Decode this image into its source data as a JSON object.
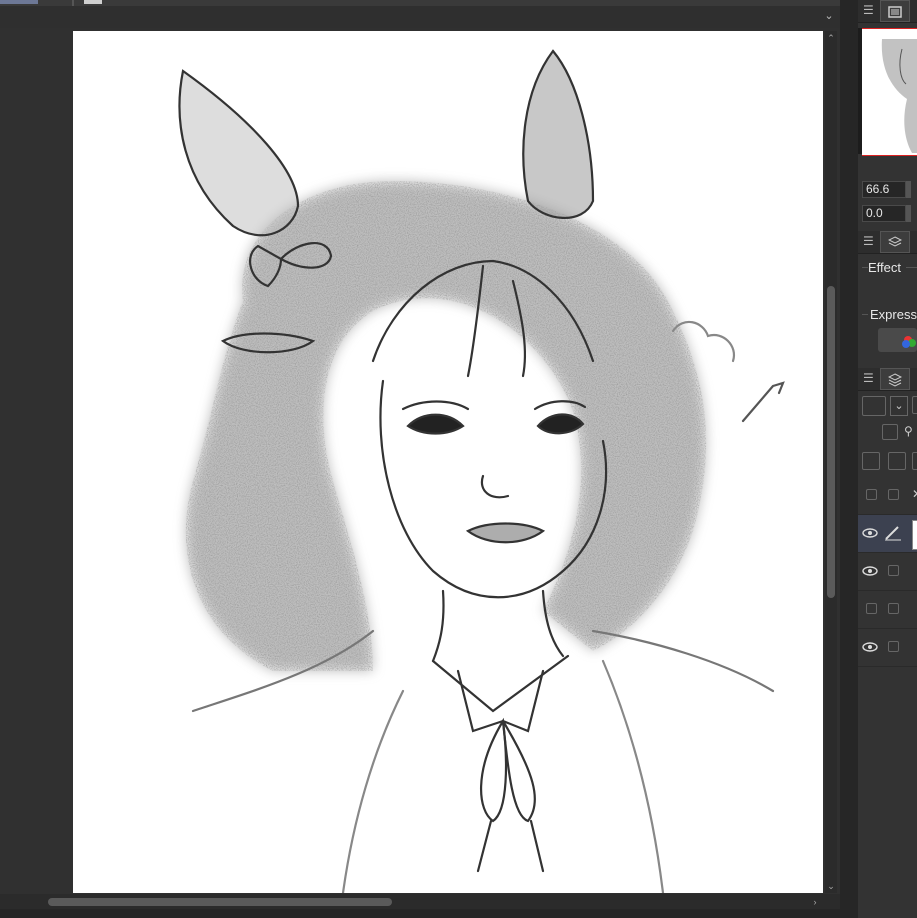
{
  "window": {
    "ribbon_menu_icon": "chevron-down-icon"
  },
  "navigator": {
    "zoom_value": "66.6",
    "rotation_value": "0.0"
  },
  "color_panel": {
    "effect_label": "Effect",
    "expression_label": "Express"
  },
  "layers": {
    "rows": [
      {
        "visible": false,
        "name": "layer-row-1"
      },
      {
        "visible": true,
        "name": "layer-row-2",
        "active": true
      },
      {
        "visible": true,
        "name": "layer-row-3"
      },
      {
        "visible": false,
        "name": "layer-row-4"
      },
      {
        "visible": true,
        "name": "layer-row-5"
      }
    ]
  },
  "colors": {
    "accent_tab": "#6d7896",
    "nav_frame": "#dd2222",
    "canvas_bg": "#ffffff"
  }
}
